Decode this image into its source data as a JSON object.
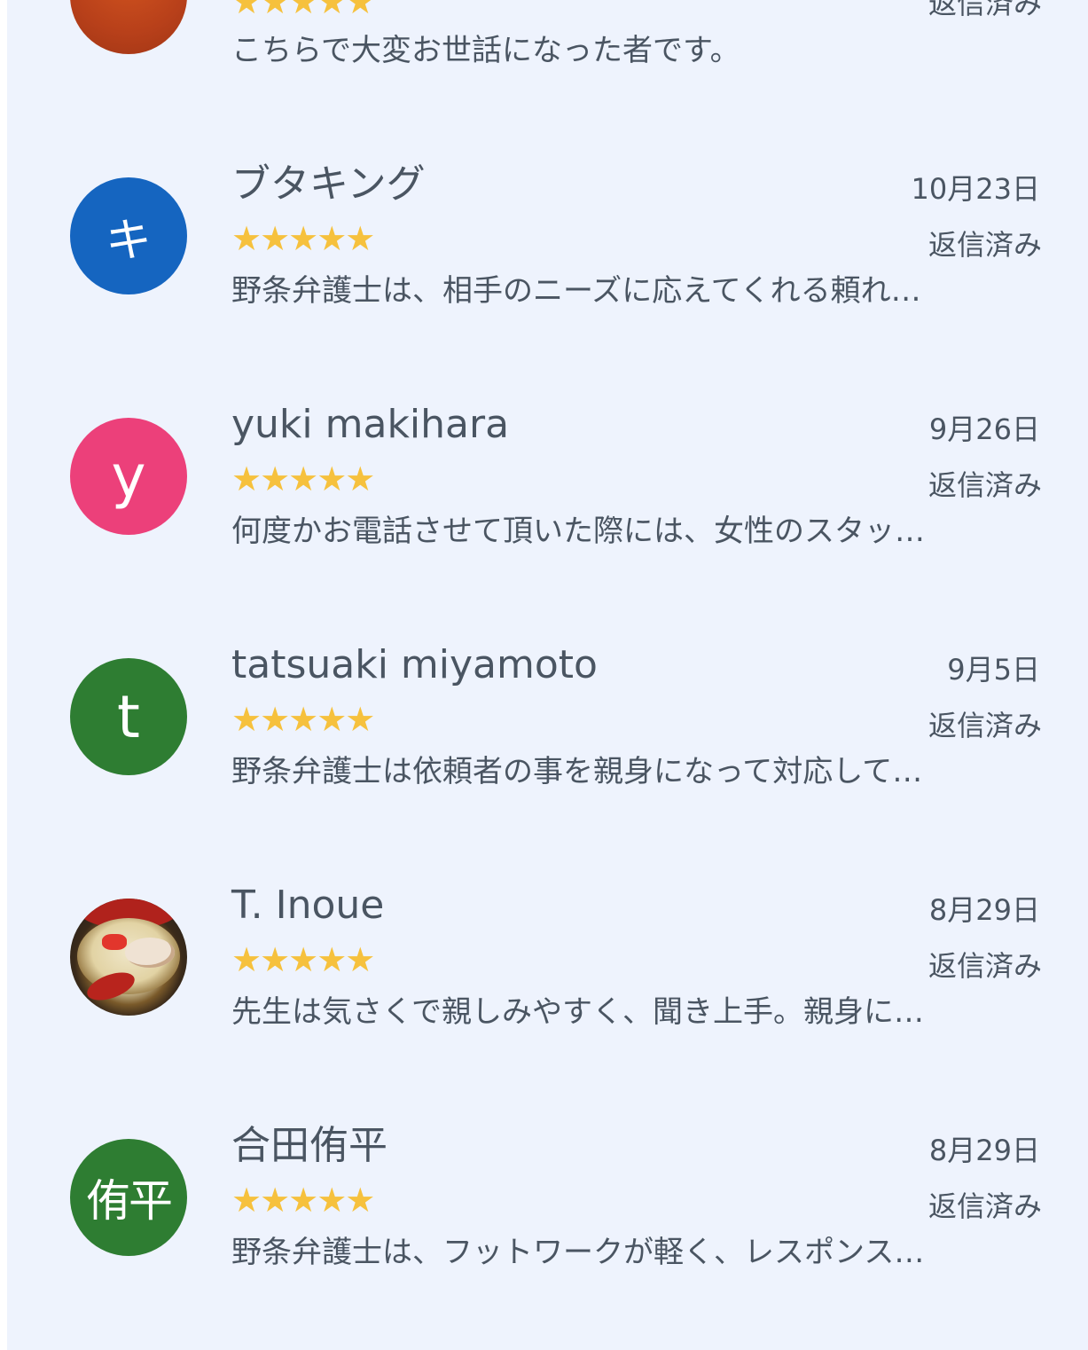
{
  "colors": {
    "background": "#eef3fd",
    "text": "#4a5562",
    "star": "#f6c13d"
  },
  "reviews": [
    {
      "avatar_icon": "orange-avatar-cropped",
      "avatar_color": "#c0461d",
      "avatar_initial": "",
      "name": "",
      "date": "",
      "rating": 5,
      "stars": "★★★★★",
      "status": "返信済み",
      "text": "こちらで大変お世話になった者です。"
    },
    {
      "avatar_icon": "letter-avatar",
      "avatar_color": "#1565c0",
      "avatar_initial": "キ",
      "name": "ブタキング",
      "date": "10月23日",
      "rating": 5,
      "stars": "★★★★★",
      "status": "返信済み",
      "text": "野条弁護士は、相手のニーズに応えてくれる頼れ…"
    },
    {
      "avatar_icon": "letter-avatar",
      "avatar_color": "#ec407a",
      "avatar_initial": "y",
      "name": "yuki makihara",
      "date": "9月26日",
      "rating": 5,
      "stars": "★★★★★",
      "status": "返信済み",
      "text": "何度かお電話させて頂いた際には、女性のスタッ…"
    },
    {
      "avatar_icon": "letter-avatar",
      "avatar_color": "#2e7d32",
      "avatar_initial": "t",
      "name": "tatsuaki miyamoto",
      "date": "9月5日",
      "rating": 5,
      "stars": "★★★★★",
      "status": "返信済み",
      "text": "野条弁護士は依頼者の事を親身になって対応して…"
    },
    {
      "avatar_icon": "ramen-photo-avatar",
      "avatar_color": "",
      "avatar_initial": "",
      "name": "T. Inoue",
      "date": "8月29日",
      "rating": 5,
      "stars": "★★★★★",
      "status": "返信済み",
      "text": "先生は気さくで親しみやすく、聞き上手。親身に…"
    },
    {
      "avatar_icon": "letter-avatar",
      "avatar_color": "#2e7d32",
      "avatar_initial": "侑平",
      "name": "合田侑平",
      "date": "8月29日",
      "rating": 5,
      "stars": "★★★★★",
      "status": "返信済み",
      "text": "野条弁護士は、フットワークが軽く、レスポンス…"
    }
  ]
}
